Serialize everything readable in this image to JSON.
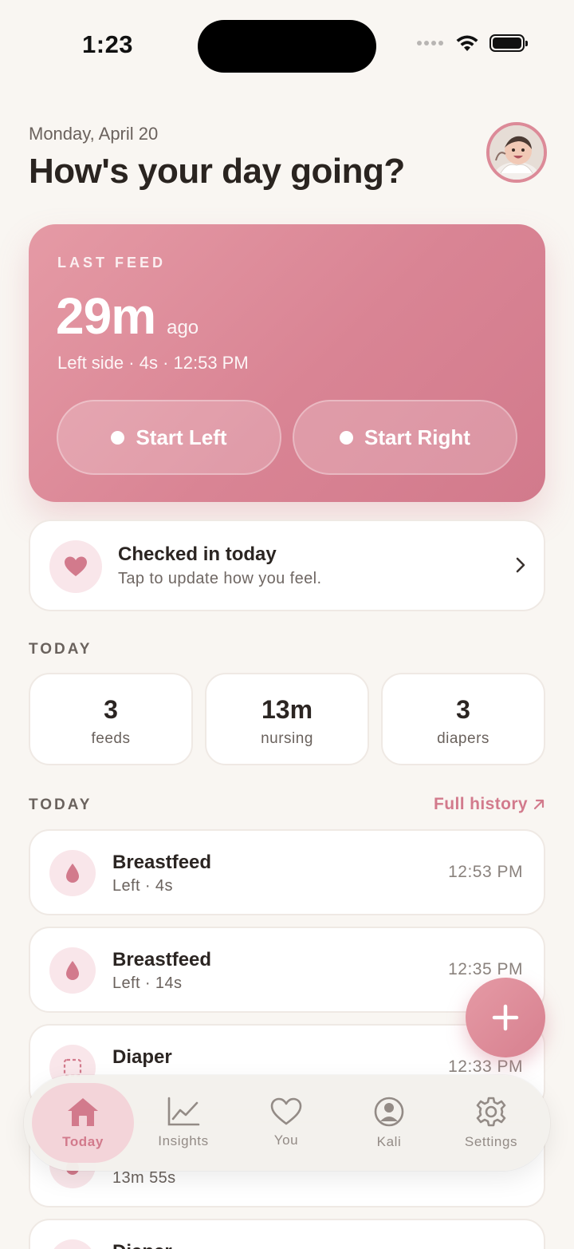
{
  "status_bar": {
    "time": "1:23"
  },
  "header": {
    "date": "Monday, April 20",
    "greeting": "How's your day going?"
  },
  "feed_card": {
    "label": "LAST FEED",
    "value": "29m",
    "suffix": "ago",
    "detail": "Left side · 4s · 12:53 PM",
    "start_left_label": "Start Left",
    "start_right_label": "Start Right"
  },
  "checkin": {
    "title": "Checked in today",
    "subtitle": "Tap to update how you feel."
  },
  "stats_section": {
    "label": "TODAY",
    "items": [
      {
        "value": "3",
        "label": "feeds"
      },
      {
        "value": "13m",
        "label": "nursing"
      },
      {
        "value": "3",
        "label": "diapers"
      }
    ]
  },
  "log_section": {
    "label": "TODAY",
    "full_history_label": "Full history",
    "entries": [
      {
        "icon": "drop-icon",
        "title": "Breastfeed",
        "subtitle": "Left · 4s",
        "time": "12:53 PM"
      },
      {
        "icon": "drop-icon",
        "title": "Breastfeed",
        "subtitle": "Left · 14s",
        "time": "12:35 PM"
      },
      {
        "icon": "diaper-icon",
        "title": "Diaper",
        "subtitle": "",
        "time": "12:33 PM"
      },
      {
        "icon": "drop-icon",
        "title": "",
        "subtitle": "13m 55s",
        "time": ""
      },
      {
        "icon": "diaper-icon",
        "title": "Diaper",
        "subtitle": "",
        "time": ""
      }
    ]
  },
  "tabbar": {
    "tabs": [
      {
        "label": "Today",
        "icon": "home-icon",
        "active": true
      },
      {
        "label": "Insights",
        "icon": "chart-icon",
        "active": false
      },
      {
        "label": "You",
        "icon": "heart-icon",
        "active": false
      },
      {
        "label": "Kali",
        "icon": "person-icon",
        "active": false
      },
      {
        "label": "Settings",
        "icon": "gear-icon",
        "active": false
      }
    ]
  },
  "colors": {
    "accent": "#d27a8c",
    "background": "#f9f6f2",
    "card_gradient_start": "#e59aa5",
    "card_gradient_end": "#d27a8c"
  }
}
